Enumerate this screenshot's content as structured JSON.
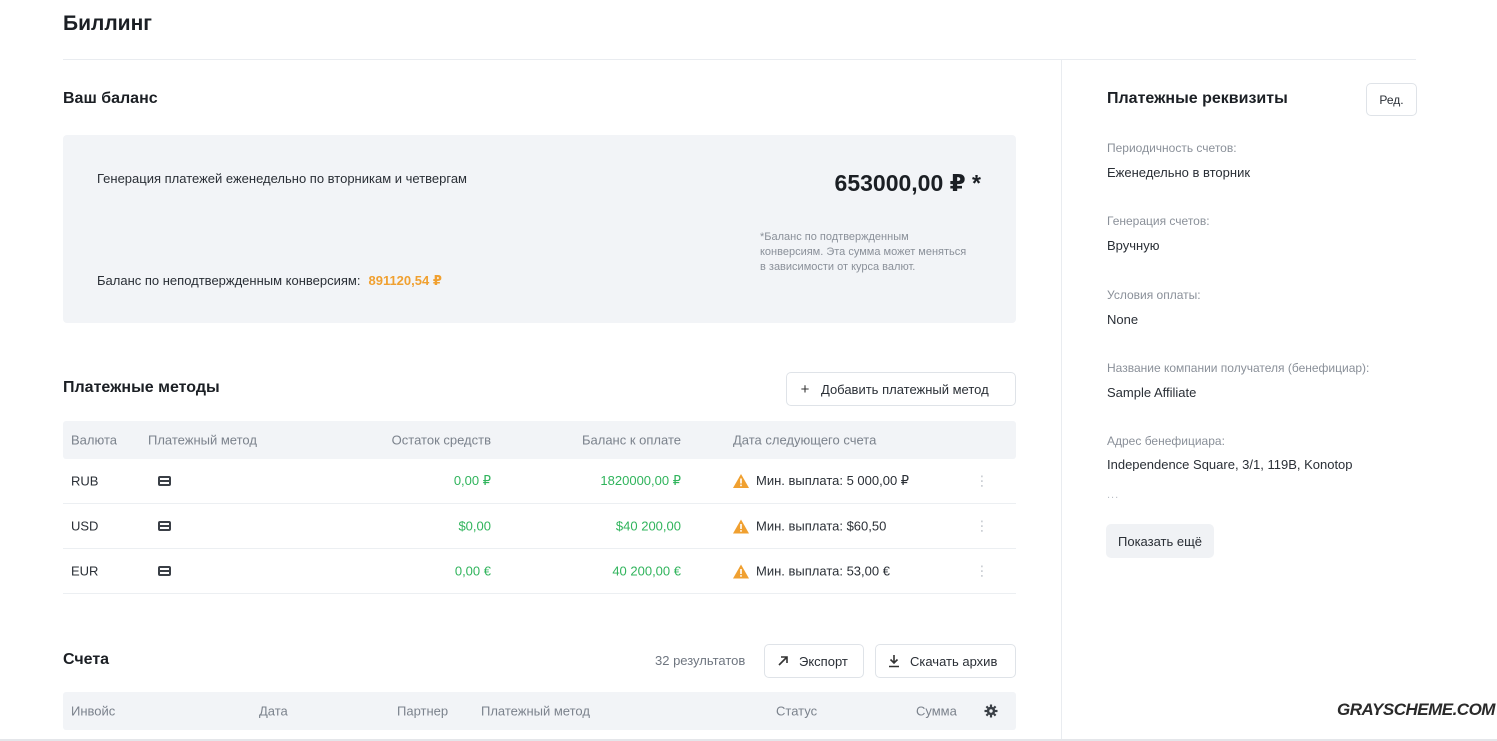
{
  "page": {
    "title": "Биллинг"
  },
  "balance": {
    "title": "Ваш баланс",
    "generation_text": "Генерация платежей еженедельно по вторникам и четвергам",
    "amount": "653000,00 ₽ *",
    "note": "*Баланс по подтвержденным конверсиям. Эта сумма может меняться в зависимости от курса валют.",
    "unconfirmed_label": "Баланс по неподтвержденным конверсиям:",
    "unconfirmed_value": "891120,54 ₽"
  },
  "payment_methods": {
    "title": "Платежные методы",
    "add_button": "Добавить платежный метод",
    "columns": {
      "currency": "Валюта",
      "method": "Платежный метод",
      "remainder": "Остаток средств",
      "balance_due": "Баланс к оплате",
      "next_invoice": "Дата следующего счета"
    },
    "rows": [
      {
        "currency": "RUB",
        "remainder": "0,00 ₽",
        "balance_due": "1820000,00 ₽",
        "next_invoice": "Мин. выплата: 5 000,00 ₽"
      },
      {
        "currency": "USD",
        "remainder": "$0,00",
        "balance_due": "$40 200,00",
        "next_invoice": "Мин. выплата: $60,50"
      },
      {
        "currency": "EUR",
        "remainder": "0,00 €",
        "balance_due": "40 200,00 €",
        "next_invoice": "Мин. выплата: 53,00 €"
      }
    ]
  },
  "invoices": {
    "title": "Счета",
    "results": "32  результатов",
    "export_button": "Экспорт",
    "download_button": "Скачать архив",
    "columns": {
      "invoice": "Инвойс",
      "date": "Дата",
      "partner": "Партнер",
      "method": "Платежный метод",
      "status": "Статус",
      "amount": "Сумма"
    }
  },
  "details": {
    "title": "Платежные реквизиты",
    "edit_button": "Ред.",
    "invoice_frequency_label": "Периодичность счетов:",
    "invoice_frequency_value": "Еженедельно в вторник",
    "invoice_generation_label": "Генерация счетов:",
    "invoice_generation_value": "Вручную",
    "payment_terms_label": "Условия оплаты:",
    "payment_terms_value": "None",
    "beneficiary_company_label": "Название компании получателя (бенефициар):",
    "beneficiary_company_value": "Sample Affiliate",
    "beneficiary_address_label": "Адрес бенефициара:",
    "beneficiary_address_value": "Independence Square, 3/1, 119B, Konotop",
    "ellipsis": "...",
    "show_more_button": "Показать ещё"
  },
  "watermark": "GRAYSCHEME.COM",
  "colors": {
    "positive": "#30b45c",
    "warning": "#f0a030",
    "panel_bg": "#f2f4f7",
    "text": "#1b1f24"
  },
  "icons": [
    "plus-icon",
    "card-icon",
    "warning-icon",
    "kebab-icon",
    "export-arrow-icon",
    "download-icon",
    "gear-icon"
  ]
}
